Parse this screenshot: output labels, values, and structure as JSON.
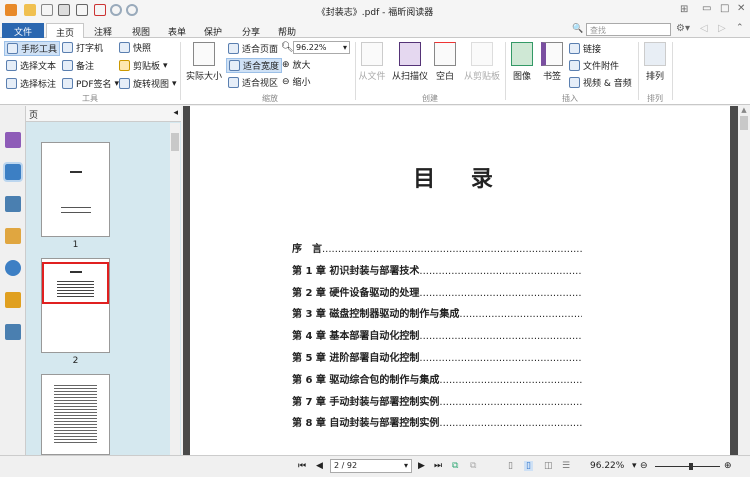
{
  "window": {
    "title": "《封装志》.pdf - 福昕阅读器"
  },
  "tabs": [
    "文件",
    "主页",
    "注释",
    "视图",
    "表单",
    "保护",
    "分享",
    "帮助"
  ],
  "search": {
    "placeholder": "查找"
  },
  "ribbon": {
    "tools": {
      "hand": "手形工具",
      "typewriter": "打字机",
      "snapshot": "快照",
      "select_text": "选择文本",
      "note": "备注",
      "clipboard": "剪贴板",
      "select_annot": "选择标注",
      "pdf_sign": "PDF签名",
      "rotate": "旋转视图",
      "label": "工具"
    },
    "zoom": {
      "actual": "实际大小",
      "fit_page": "适合页面",
      "fit_width": "适合宽度",
      "fit_visible": "适合视区",
      "zoom_value": "96.22%",
      "zoom_in": "放大",
      "zoom_out": "缩小",
      "label": "缩放"
    },
    "create": {
      "from_file": "从文件",
      "from_scanner": "从扫描仪",
      "blank": "空白",
      "from_clipboard": "从剪贴板",
      "label": "创建"
    },
    "insert": {
      "image": "图像",
      "bookmark": "书签",
      "link": "链接",
      "attachment": "文件附件",
      "video": "视频 & 音频",
      "label": "插入"
    },
    "arrange": {
      "arrange": "排列",
      "label": "排列"
    }
  },
  "thumbs": {
    "header": "页",
    "pages": [
      "1",
      "2"
    ]
  },
  "document": {
    "title": "目 录",
    "toc": [
      "序　言",
      "第 1 章  初识封装与部署技术",
      "第 2 章  硬件设备驱动的处理",
      "第 3 章  磁盘控制器驱动的制作与集成",
      "第 4 章  基本部署自动化控制",
      "第 5 章  进阶部署自动化控制",
      "第 6 章  驱动综合包的制作与集成",
      "第 7 章  手动封装与部署控制实例",
      "第 8 章  自动封装与部署控制实例"
    ],
    "dots": "......................................................................................................"
  },
  "status": {
    "page": "2 / 92",
    "zoom": "96.22%",
    "zoom_fraction": 0.55
  }
}
